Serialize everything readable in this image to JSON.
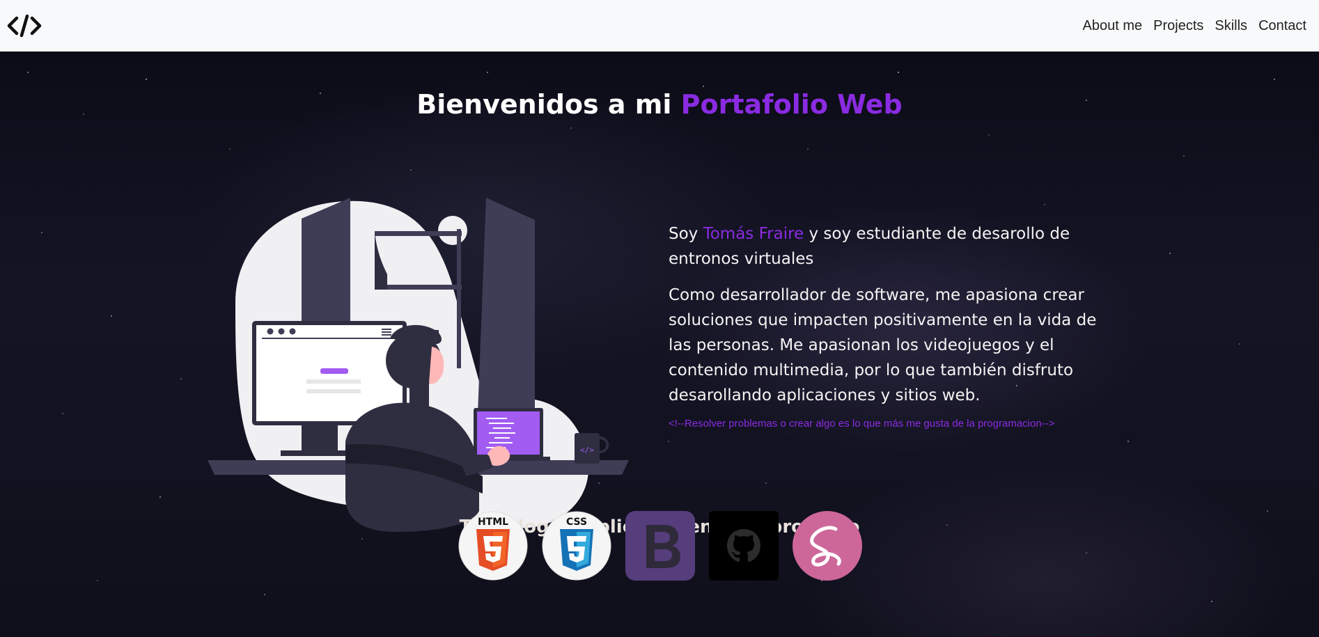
{
  "navbar": {
    "brand_icon": "code-brackets-icon",
    "links": [
      "About me",
      "Projects",
      "Skills",
      "Contact"
    ]
  },
  "hero": {
    "title_prefix": "Bienvenidos a mi ",
    "title_accent": "Portafolio Web"
  },
  "about": {
    "intro_prefix": "Soy ",
    "name": "Tomás Fraire",
    "intro_suffix": " y soy estudiante de desarollo de entronos virtuales",
    "description": "Como desarrollador de software, me apasiona crear soluciones que impacten positivamente en la vida de las personas. Me apasionan los videojuegos y el contenido multimedia, por lo que también disfruto desarollando aplicaciones y sitios web.",
    "comment": "<!--Resolver problemas o crear algo es lo que más me gusta de la programacion-->"
  },
  "tech": {
    "title": "Tecnologias aplicadas en este proyecto",
    "html_label": "HTML",
    "css_label": "CSS",
    "icons": [
      "html5-icon",
      "css3-icon",
      "bootstrap-icon",
      "github-icon",
      "sass-icon"
    ]
  },
  "colors": {
    "accent": "#8a2be2",
    "navbar_bg": "#f8f9fa",
    "page_bg": "#10101c"
  }
}
